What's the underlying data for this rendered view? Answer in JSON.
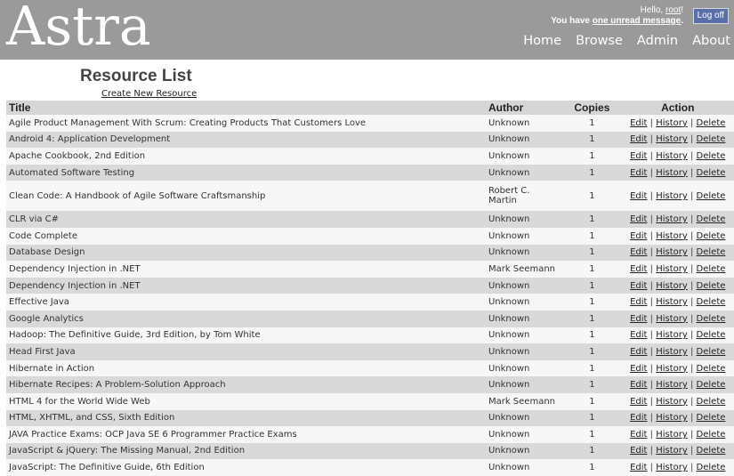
{
  "header": {
    "logo": "Astra",
    "greeting_prefix": "Hello, ",
    "username": "root",
    "greeting_suffix": "!",
    "message_prefix": "You have ",
    "message_link": "one unread message",
    "message_suffix": ".",
    "logoff_label": "Log off",
    "nav": [
      "Home",
      "Browse",
      "Admin",
      "About"
    ]
  },
  "page": {
    "title": "Resource List",
    "create_link": "Create New Resource"
  },
  "table": {
    "columns": [
      "Title",
      "Author",
      "Copies",
      "Action"
    ],
    "actions": {
      "edit": "Edit",
      "history": "History",
      "delete": "Delete",
      "separator": "|"
    },
    "rows": [
      {
        "title": "Agile Product Management With Scrum: Creating Products That Customers Love",
        "author": "Unknown",
        "copies": "1"
      },
      {
        "title": "Android 4: Application Development",
        "author": "Unknown",
        "copies": "1"
      },
      {
        "title": "Apache Cookbook, 2nd Edition",
        "author": "Unknown",
        "copies": "1"
      },
      {
        "title": "Automated Software Testing",
        "author": "Unknown",
        "copies": "1"
      },
      {
        "title": "Clean Code: A Handbook of Agile Software Craftsmanship",
        "author": "Robert C. Martin",
        "copies": "1"
      },
      {
        "title": "CLR via C#",
        "author": "Unknown",
        "copies": "1"
      },
      {
        "title": "Code Complete",
        "author": "Unknown",
        "copies": "1"
      },
      {
        "title": "Database Design",
        "author": "Unknown",
        "copies": "1"
      },
      {
        "title": "Dependency Injection in .NET",
        "author": "Mark Seemann",
        "copies": "1"
      },
      {
        "title": "Dependency Injection in .NET",
        "author": "Unknown",
        "copies": "1"
      },
      {
        "title": "Effective Java",
        "author": "Unknown",
        "copies": "1"
      },
      {
        "title": "Google Analytics",
        "author": "Unknown",
        "copies": "1"
      },
      {
        "title": "Hadoop: The Definitive Guide, 3rd Edition, by Tom White",
        "author": "Unknown",
        "copies": "1"
      },
      {
        "title": "Head First Java",
        "author": "Unknown",
        "copies": "1"
      },
      {
        "title": "Hibernate in Action",
        "author": "Unknown",
        "copies": "1"
      },
      {
        "title": "Hibernate Recipes: A Problem-Solution Approach",
        "author": "Unknown",
        "copies": "1"
      },
      {
        "title": "HTML 4 for the World Wide Web",
        "author": "Mark Seemann",
        "copies": "1"
      },
      {
        "title": "HTML, XHTML, and CSS, Sixth Edition",
        "author": "Unknown",
        "copies": "1"
      },
      {
        "title": "JAVA Practice Exams: OCP Java SE 6 Programmer Practice Exams",
        "author": "Unknown",
        "copies": "1"
      },
      {
        "title": "JavaScript & jQuery: The Missing Manual, 2nd Edition",
        "author": "Unknown",
        "copies": "1"
      },
      {
        "title": "JavaScript: The Definitive Guide, 6th Edition",
        "author": "Unknown",
        "copies": "1"
      }
    ]
  }
}
